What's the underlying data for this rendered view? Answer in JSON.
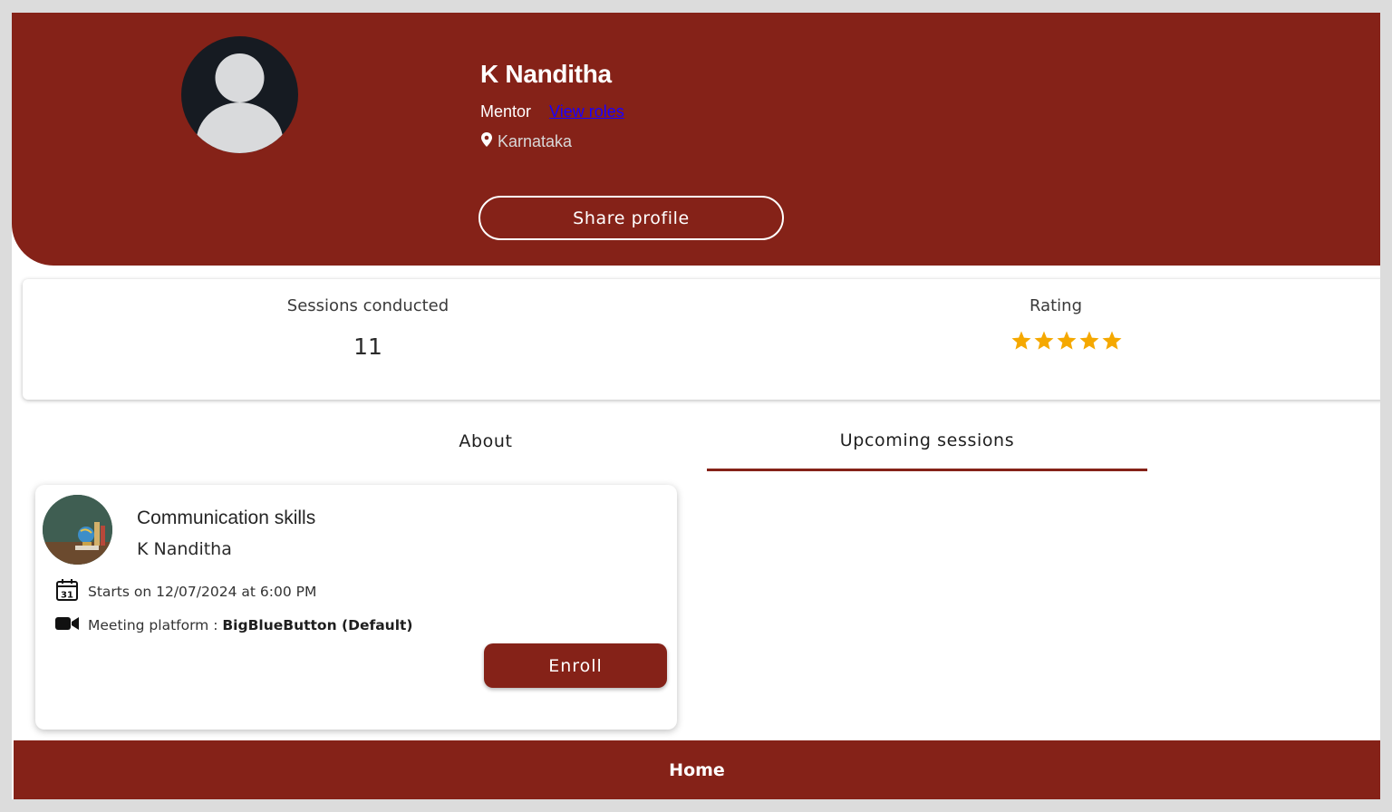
{
  "profile": {
    "name": "K Nanditha",
    "role": "Mentor",
    "view_roles_link": "View roles",
    "location": "Karnataka",
    "share_label": "Share profile"
  },
  "stats": {
    "sessions_label": "Sessions conducted",
    "sessions_value": "11",
    "rating_label": "Rating",
    "rating_stars": 5,
    "rating_max": 5,
    "star_color": "#f5a800"
  },
  "tabs": [
    {
      "label": "About",
      "active": false
    },
    {
      "label": "Upcoming sessions",
      "active": true
    }
  ],
  "session_card": {
    "title": "Communication skills",
    "mentor": "K Nanditha",
    "date_text": "Starts on 12/07/2024 at 6:00 PM",
    "calendar_day": "31",
    "platform_label": "Meeting platform : ",
    "platform_value": "BigBlueButton (Default)",
    "enroll_label": "Enroll"
  },
  "footer": {
    "home_label": "Home"
  },
  "colors": {
    "brand": "#852218",
    "link": "#1a00ff"
  }
}
